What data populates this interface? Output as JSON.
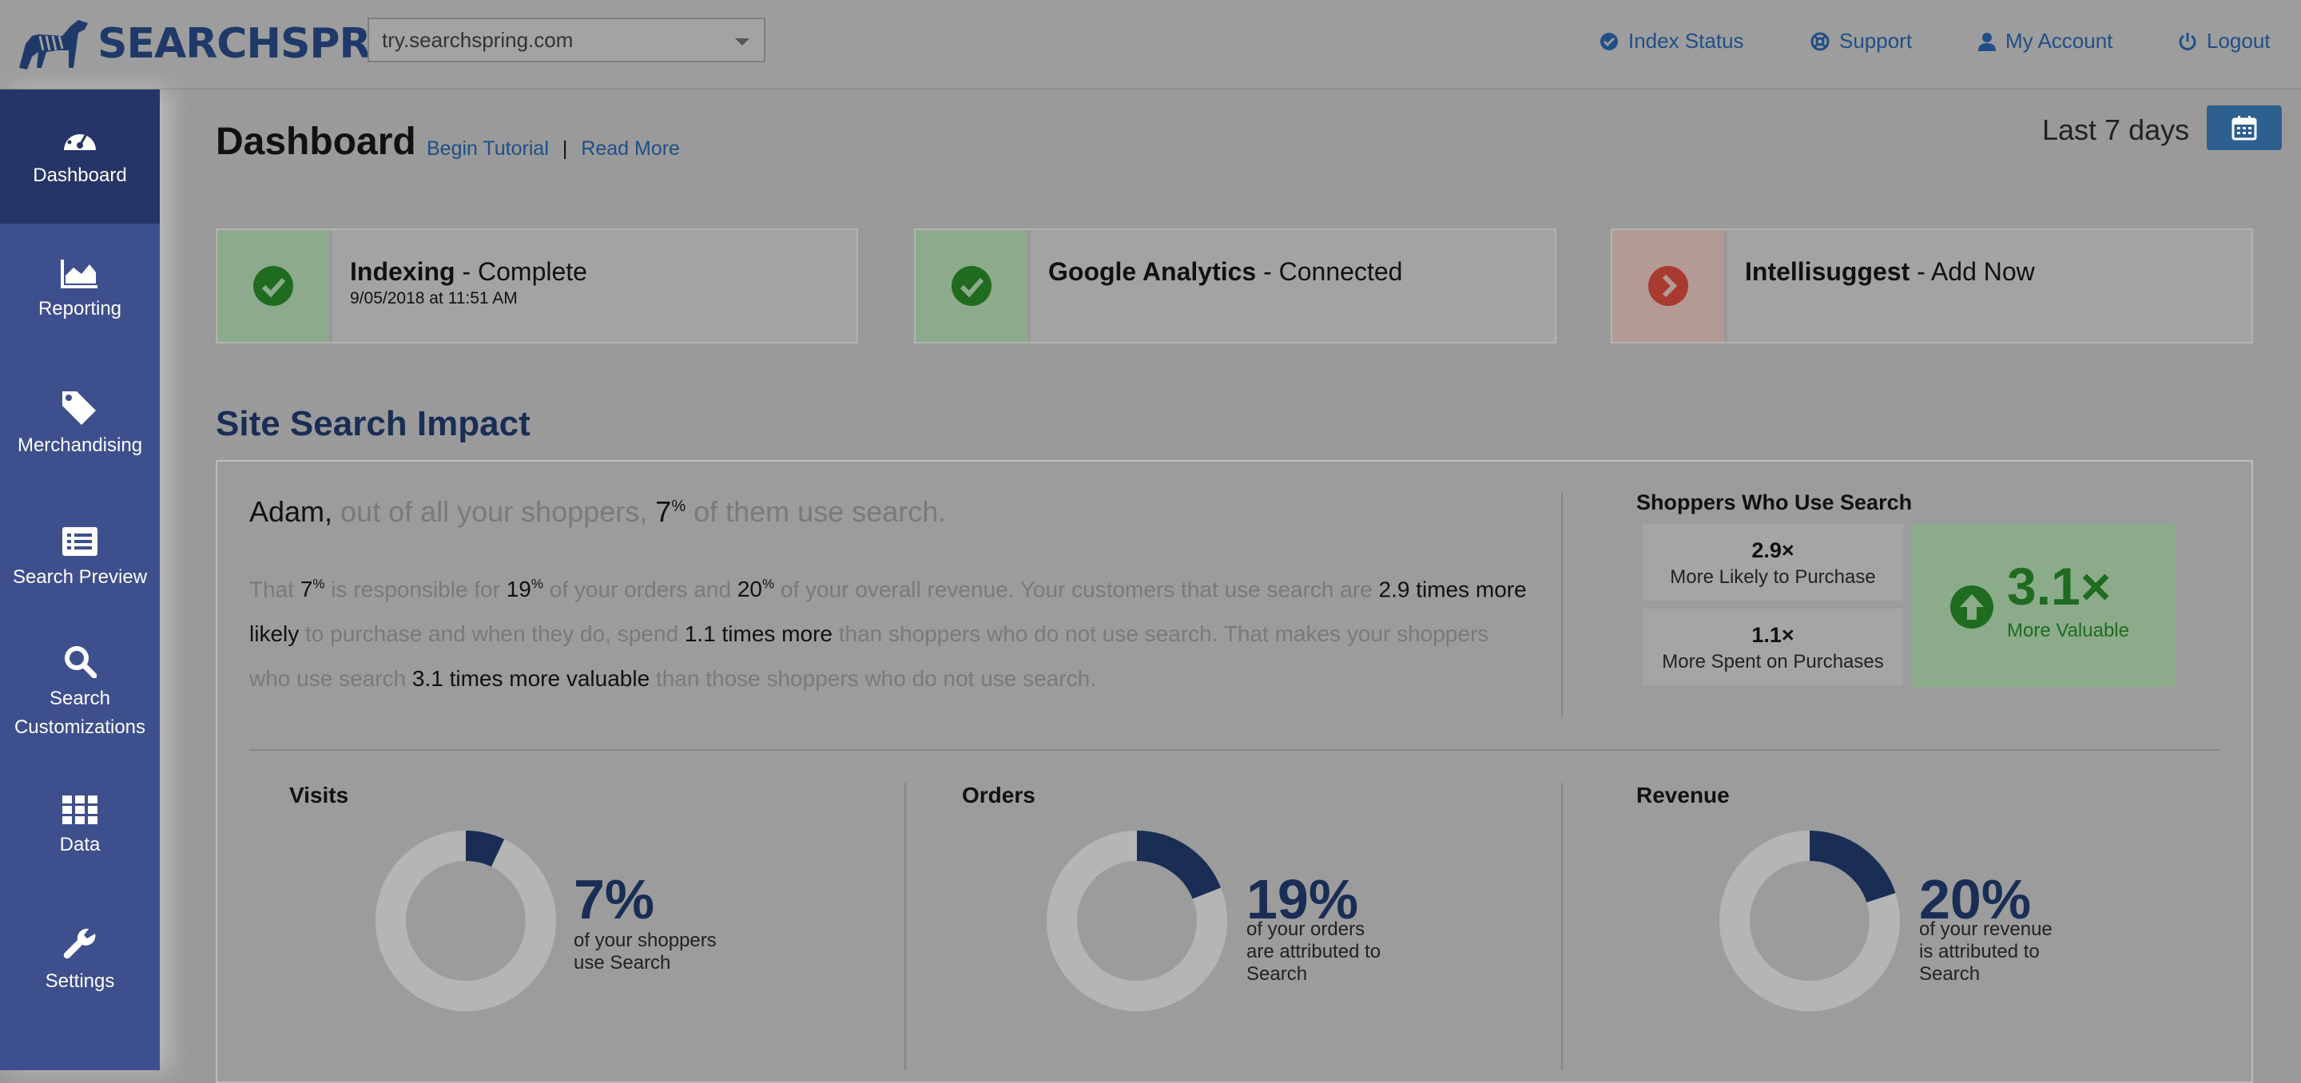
{
  "brand": {
    "logo_text": "SEARCHSPRING",
    "registered": "®"
  },
  "site_selector": {
    "value": "try.searchspring.com"
  },
  "topnav": {
    "index_status": "Index Status",
    "support": "Support",
    "my_account": "My Account",
    "logout": "Logout"
  },
  "sidebar": {
    "items": [
      {
        "label": "Dashboard",
        "icon": "dashboard-icon"
      },
      {
        "label": "Reporting",
        "icon": "chart-icon"
      },
      {
        "label": "Merchandising",
        "icon": "tags-icon"
      },
      {
        "label": "Search Preview",
        "icon": "list-icon"
      },
      {
        "label": "Search Customizations",
        "icon": "search-icon"
      },
      {
        "label": "Data",
        "icon": "grid-icon"
      },
      {
        "label": "Settings",
        "icon": "wrench-icon"
      }
    ]
  },
  "header": {
    "title": "Dashboard",
    "begin_tutorial": "Begin Tutorial",
    "separator": "|",
    "read_more": "Read More",
    "date_range": "Last 7 days"
  },
  "status_cards": [
    {
      "name": "Indexing",
      "status": " - Complete",
      "sub": "9/05/2018 at 11:51 AM",
      "state": "ok"
    },
    {
      "name": "Google Analytics",
      "status": " - Connected",
      "sub": "",
      "state": "ok"
    },
    {
      "name": "Intellisuggest",
      "status": " - Add Now",
      "sub": "",
      "state": "action"
    }
  ],
  "impact": {
    "section_title": "Site Search Impact",
    "headline": {
      "name": "Adam,",
      "part1": " out of all your shoppers, ",
      "pct": "7",
      "pct_sup": "%",
      "part2": " of them use search."
    },
    "paragraph": {
      "t1": "That ",
      "v1": "7",
      "v1_sup": "%",
      "t2": " is responsible for ",
      "v2": "19",
      "v2_sup": "%",
      "t3": " of your orders and ",
      "v3": "20",
      "v3_sup": "%",
      "t4": " of your overall revenue. Your customers that use search are ",
      "v4": "2.9 times more likely",
      "t5": " to purchase and when they do, spend ",
      "v5": "1.1 times more",
      "t6": " than shoppers who do not use search. That makes your shoppers who use search ",
      "v6": "3.1 times more valuable",
      "t7": " than those shoppers who do not use search."
    },
    "shoppers_who_use_search": {
      "title": "Shoppers Who Use Search",
      "likely_value": "2.9×",
      "likely_label": "More Likely to Purchase",
      "spent_value": "1.1×",
      "spent_label": "More Spent on Purchases",
      "valuable_value": "3.1×",
      "valuable_label": "More Valuable"
    },
    "metrics": [
      {
        "title": "Visits",
        "pct_label": "7%",
        "pct": 7,
        "desc1": "of your shoppers",
        "desc2": "use Search",
        "desc3": ""
      },
      {
        "title": "Orders",
        "pct_label": "19%",
        "pct": 19,
        "desc1": "of your orders",
        "desc2": "are attributed to",
        "desc3": "Search"
      },
      {
        "title": "Revenue",
        "pct_label": "20%",
        "pct": 20,
        "desc1": "of your revenue",
        "desc2": "is attributed to",
        "desc3": "Search"
      }
    ]
  },
  "colors": {
    "sidebar": "#3d4f8c",
    "sidebar_active": "#253568",
    "link": "#1f4f86",
    "donut_fill": "#1a2d55",
    "donut_track": "#b5b5b5",
    "success": "#1f6b1f",
    "danger": "#a83a2f"
  }
}
